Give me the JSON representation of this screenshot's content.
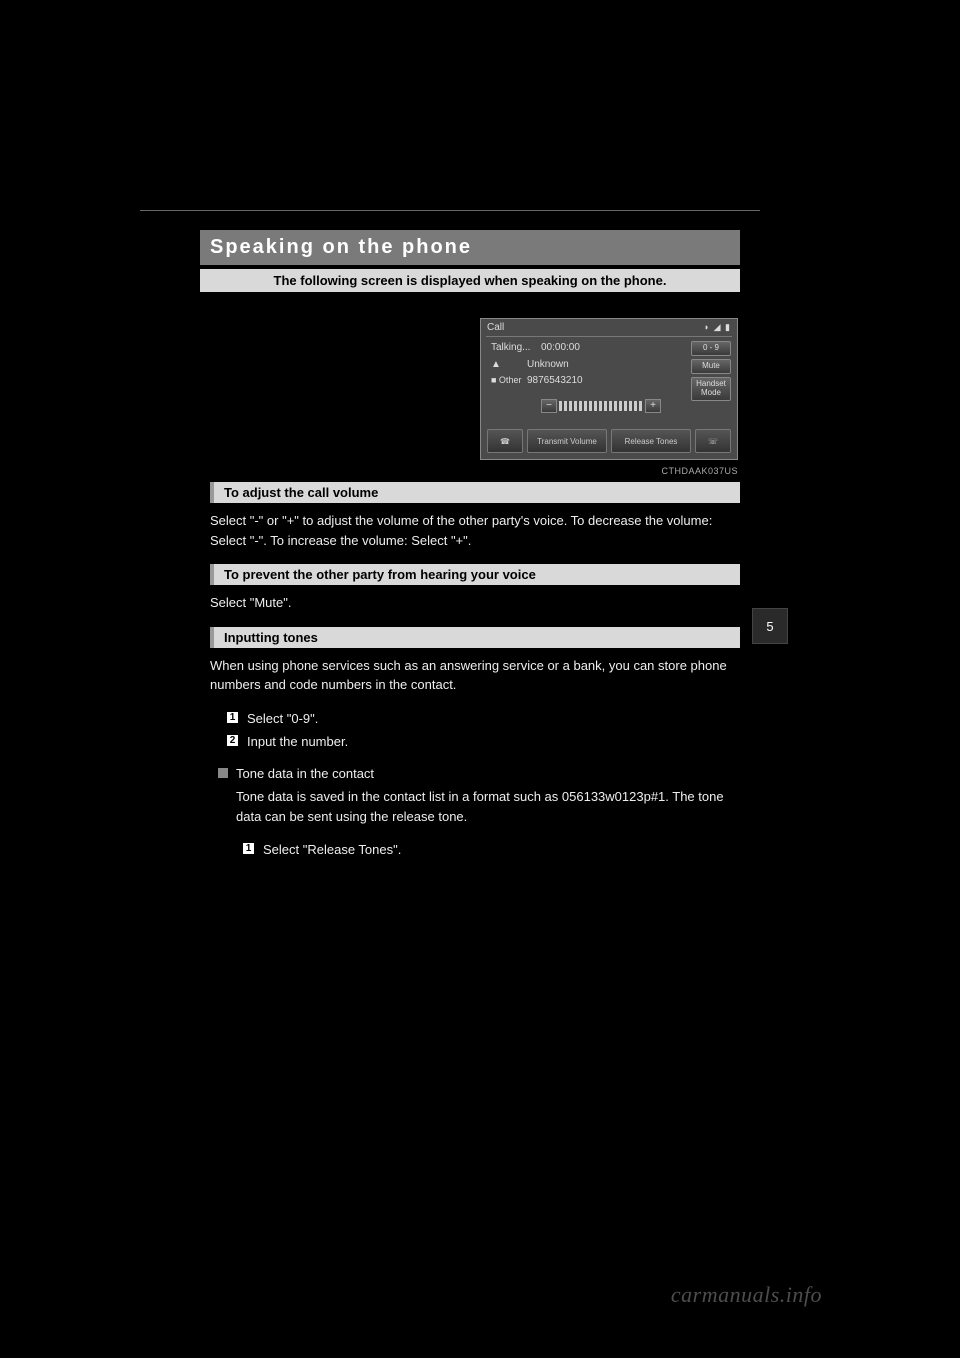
{
  "title": "Speaking on the phone",
  "intro": "The following screen is displayed when speaking on the phone.",
  "screenshot": {
    "header": "Call",
    "status_icons": "◗ ◢ ▮",
    "talking": "Talking...",
    "time": "00:00:00",
    "person_icon": "▲",
    "name": "Unknown",
    "other_label": "■ Other",
    "number": "9876543210",
    "btn09": "0 - 9",
    "btnMute": "Mute",
    "btnHandset": "Handset\nMode",
    "volMinus": "−",
    "volPlus": "+",
    "hangup_icon": "☎",
    "transmit": "Transmit Volume",
    "release": "Release Tones",
    "call_icon": "☏",
    "credit": "CTHDAAK037US"
  },
  "sections": {
    "adjust": {
      "heading": "To adjust the call volume",
      "body": "Select \"-\" or \"+\" to adjust the volume of the other party's voice. To decrease the volume: Select \"-\". To increase the volume: Select \"+\"."
    },
    "prevent": {
      "heading": "To prevent the other party from hearing your voice",
      "body": "Select \"Mute\"."
    },
    "tones": {
      "heading": "Inputting tones",
      "lead": "When using phone services such as an answering service or a bank, you can store phone numbers and code numbers in the contact.",
      "step1": "Select \"0-9\".",
      "step2": "Input the number.",
      "sq_head": "Tone data in the contact",
      "sq_body": "Tone data is saved in the contact list in a format such as 056133w0123p#1. The tone data can be sent using the release tone.",
      "step1b": "Select \"Release Tones\"."
    }
  },
  "side_tab": "5",
  "watermark": "carmanuals.info"
}
